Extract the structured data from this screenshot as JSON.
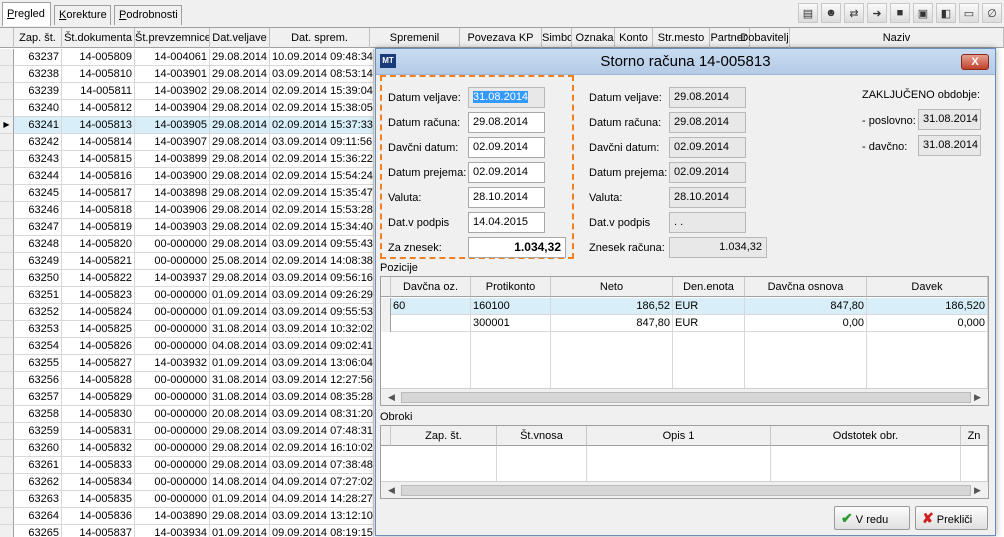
{
  "tabs": [
    {
      "label": "Pregled",
      "u": "P",
      "rest": "regled",
      "active": true
    },
    {
      "label": "Korekture",
      "u": "K",
      "rest": "orekture",
      "active": false
    },
    {
      "label": "Podrobnosti",
      "u": "P",
      "rest": "odrobnosti",
      "active": false
    }
  ],
  "toolbar": [
    "report-icon",
    "users-icon",
    "transfer-icon",
    "move-icon",
    "stop-icon",
    "screen-icon",
    "window-icon",
    "folder-icon",
    "attach-icon"
  ],
  "grid": {
    "columns": [
      "Zap. št.",
      "Št.dokumenta",
      "Št.prevzemnice",
      "Dat.veljave",
      "Dat. sprem.",
      "Spremenil",
      "Povezava KP",
      "Simbol",
      "Oznaka",
      "Konto",
      "Str.mesto",
      "Partner",
      "Dobavitelj",
      "Naziv"
    ],
    "rows": [
      [
        "63237",
        "14-005809",
        "14-004061",
        "29.08.2014",
        "10.09.2014 09:48:34"
      ],
      [
        "63238",
        "14-005810",
        "14-003901",
        "29.08.2014",
        "03.09.2014 08:53:14"
      ],
      [
        "63239",
        "14-005811",
        "14-003902",
        "29.08.2014",
        "02.09.2014 15:39:04"
      ],
      [
        "63240",
        "14-005812",
        "14-003904",
        "29.08.2014",
        "02.09.2014 15:38:05"
      ],
      [
        "63241",
        "14-005813",
        "14-003905",
        "29.08.2014",
        "02.09.2014 15:37:33"
      ],
      [
        "63242",
        "14-005814",
        "14-003907",
        "29.08.2014",
        "03.09.2014 09:11:56"
      ],
      [
        "63243",
        "14-005815",
        "14-003899",
        "29.08.2014",
        "02.09.2014 15:36:22"
      ],
      [
        "63244",
        "14-005816",
        "14-003900",
        "29.08.2014",
        "02.09.2014 15:54:24"
      ],
      [
        "63245",
        "14-005817",
        "14-003898",
        "29.08.2014",
        "02.09.2014 15:35:47"
      ],
      [
        "63246",
        "14-005818",
        "14-003906",
        "29.08.2014",
        "02.09.2014 15:53:28"
      ],
      [
        "63247",
        "14-005819",
        "14-003903",
        "29.08.2014",
        "02.09.2014 15:34:40"
      ],
      [
        "63248",
        "14-005820",
        "00-000000",
        "29.08.2014",
        "03.09.2014 09:55:43"
      ],
      [
        "63249",
        "14-005821",
        "00-000000",
        "25.08.2014",
        "02.09.2014 14:08:38"
      ],
      [
        "63250",
        "14-005822",
        "14-003937",
        "29.08.2014",
        "03.09.2014 09:56:16"
      ],
      [
        "63251",
        "14-005823",
        "00-000000",
        "01.09.2014",
        "03.09.2014 09:26:29"
      ],
      [
        "63252",
        "14-005824",
        "00-000000",
        "01.09.2014",
        "03.09.2014 09:55:53"
      ],
      [
        "63253",
        "14-005825",
        "00-000000",
        "31.08.2014",
        "03.09.2014 10:32:02"
      ],
      [
        "63254",
        "14-005826",
        "00-000000",
        "04.08.2014",
        "03.09.2014 09:02:41"
      ],
      [
        "63255",
        "14-005827",
        "14-003932",
        "01.09.2014",
        "03.09.2014 13:06:04"
      ],
      [
        "63256",
        "14-005828",
        "00-000000",
        "31.08.2014",
        "03.09.2014 12:27:56"
      ],
      [
        "63257",
        "14-005829",
        "00-000000",
        "31.08.2014",
        "03.09.2014 08:35:28"
      ],
      [
        "63258",
        "14-005830",
        "00-000000",
        "20.08.2014",
        "03.09.2014 08:31:20"
      ],
      [
        "63259",
        "14-005831",
        "00-000000",
        "29.08.2014",
        "03.09.2014 07:48:31"
      ],
      [
        "63260",
        "14-005832",
        "00-000000",
        "29.08.2014",
        "02.09.2014 16:10:02"
      ],
      [
        "63261",
        "14-005833",
        "00-000000",
        "29.08.2014",
        "03.09.2014 07:38:48"
      ],
      [
        "63262",
        "14-005834",
        "00-000000",
        "14.08.2014",
        "04.09.2014 07:27:02"
      ],
      [
        "63263",
        "14-005835",
        "00-000000",
        "01.09.2014",
        "04.09.2014 14:28:27"
      ],
      [
        "63264",
        "14-005836",
        "14-003890",
        "29.08.2014",
        "03.09.2014 13:12:10"
      ],
      [
        "63265",
        "14-005837",
        "14-003934",
        "01.09.2014",
        "09.09.2014 08:19:15"
      ]
    ],
    "selected_index": 4
  },
  "dialog": {
    "title": "Storno računa  14-005813",
    "logo": "MT",
    "close": "X",
    "left_fields": [
      {
        "label": "Datum veljave:",
        "value": "31.08.2014"
      },
      {
        "label": "Datum računa:",
        "value": "29.08.2014"
      },
      {
        "label": "Davčni datum:",
        "value": "02.09.2014"
      },
      {
        "label": "Datum prejema:",
        "value": "02.09.2014"
      },
      {
        "label": "Valuta:",
        "value": "28.10.2014"
      },
      {
        "label": "Dat.v podpis",
        "value": "14.04.2015"
      },
      {
        "label": "Za znesek:",
        "value": "1.034,32"
      }
    ],
    "mid_fields": [
      {
        "label": "Datum veljave:",
        "value": "29.08.2014"
      },
      {
        "label": "Datum računa:",
        "value": "29.08.2014"
      },
      {
        "label": "Davčni datum:",
        "value": "02.09.2014"
      },
      {
        "label": "Datum prejema:",
        "value": "02.09.2014"
      },
      {
        "label": "Valuta:",
        "value": "28.10.2014"
      },
      {
        "label": "Dat.v podpis",
        "value": " .  ."
      },
      {
        "label": "Znesek računa:",
        "value": "1.034,32"
      }
    ],
    "closed_period": {
      "title": "ZAKLJUČENO obdobje:",
      "poslovno_label": "- poslovno:",
      "poslovno": "31.08.2014",
      "davcno_label": "- davčno:",
      "davcno": "31.08.2014"
    },
    "pozicije": {
      "label": "Pozicije",
      "columns": [
        "Davčna oz.",
        "Protikonto",
        "Neto",
        "Den.enota",
        "Davčna osnova",
        "Davek"
      ],
      "rows": [
        [
          "60",
          "160100",
          "186,52",
          "EUR",
          "847,80",
          "186,520"
        ],
        [
          "",
          "300001",
          "847,80",
          "EUR",
          "0,00",
          "0,000"
        ]
      ]
    },
    "obroki": {
      "label": "Obroki",
      "columns": [
        "Zap. št.",
        "Št.vnosa",
        "Opis 1",
        "Odstotek obr.",
        "Zn"
      ]
    },
    "ok": "V redu",
    "cancel": "Prekliči"
  }
}
